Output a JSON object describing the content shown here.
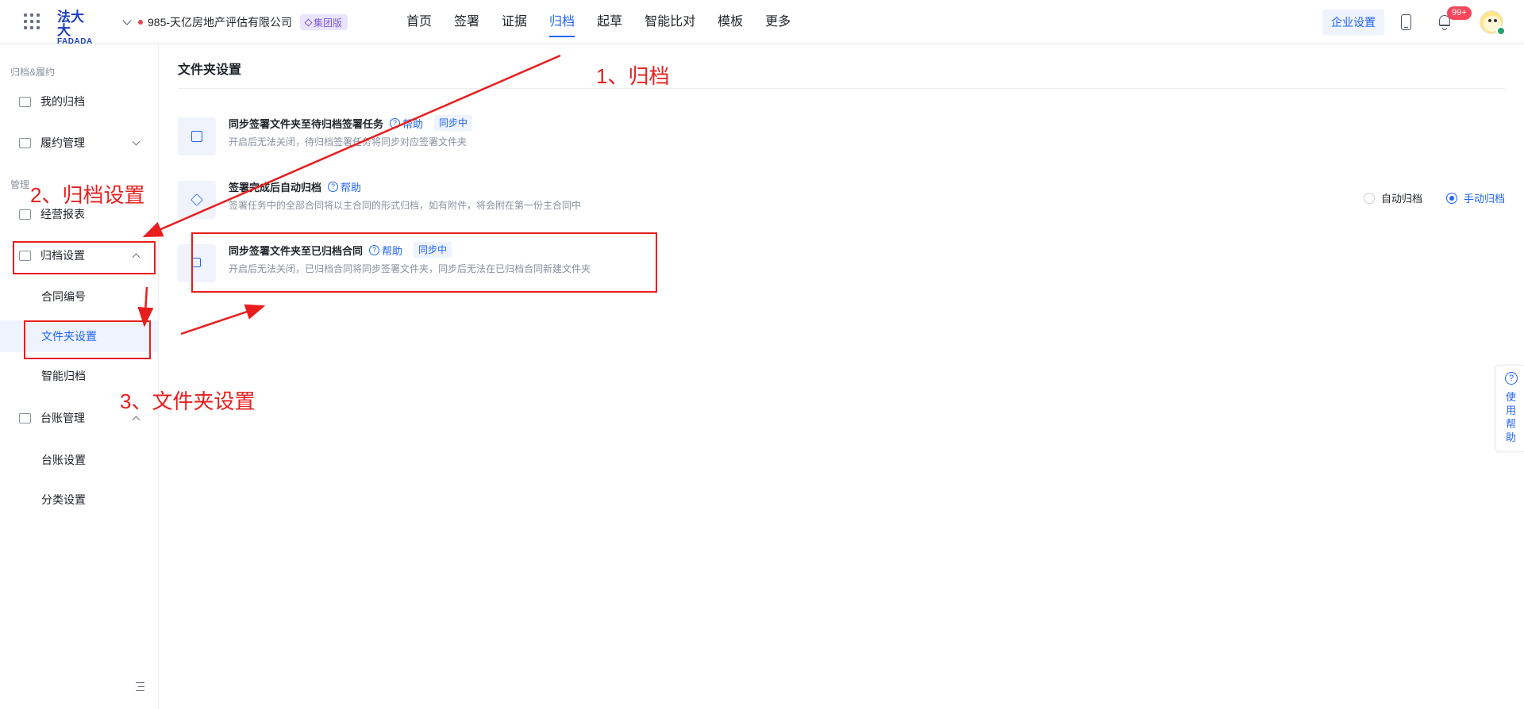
{
  "header": {
    "logo_cn": "法大大",
    "logo_en": "FADADA",
    "org_name": "985-天亿房地产评估有限公司",
    "org_badge": "集团版",
    "nav": [
      "首页",
      "签署",
      "证据",
      "归档",
      "起草",
      "智能比对",
      "模板",
      "更多"
    ],
    "active_nav": "归档",
    "enterprise_settings": "企业设置",
    "notification_count": "99+"
  },
  "sidebar": {
    "group_archive": "归档&履约",
    "my_archive": "我的归档",
    "performance": "履约管理",
    "group_manage": "管理",
    "reports": "经营报表",
    "archive_settings": "归档设置",
    "contract_number": "合同编号",
    "folder_settings": "文件夹设置",
    "smart_archive": "智能归档",
    "ledger": "台账管理",
    "ledger_settings": "台账设置",
    "category_settings": "分类设置"
  },
  "content": {
    "title": "文件夹设置",
    "help_label": "帮助",
    "syncing_label": "同步中",
    "rows": [
      {
        "title": "同步签署文件夹至待归档签署任务",
        "desc": "开启后无法关闭，待归档签署任务将同步对应签署文件夹"
      },
      {
        "title": "签署完成后自动归档",
        "desc": "签署任务中的全部合同将以主合同的形式归档，如有附件，将会附在第一份主合同中",
        "options": [
          "自动归档",
          "手动归档"
        ],
        "selected": "手动归档"
      },
      {
        "title": "同步签署文件夹至已归档合同",
        "desc": "开启后无法关闭，已归档合同将同步签署文件夹，同步后无法在已归档合同新建文件夹"
      }
    ]
  },
  "help_tab": [
    "使",
    "用",
    "帮",
    "助"
  ],
  "annotations": {
    "step1": "1、归档",
    "step2": "2、归档设置",
    "step3": "3、文件夹设置"
  },
  "colors": {
    "accent": "#2164f3",
    "annotation": "#e81e1e",
    "badge_purple": "#7c5cd9"
  }
}
